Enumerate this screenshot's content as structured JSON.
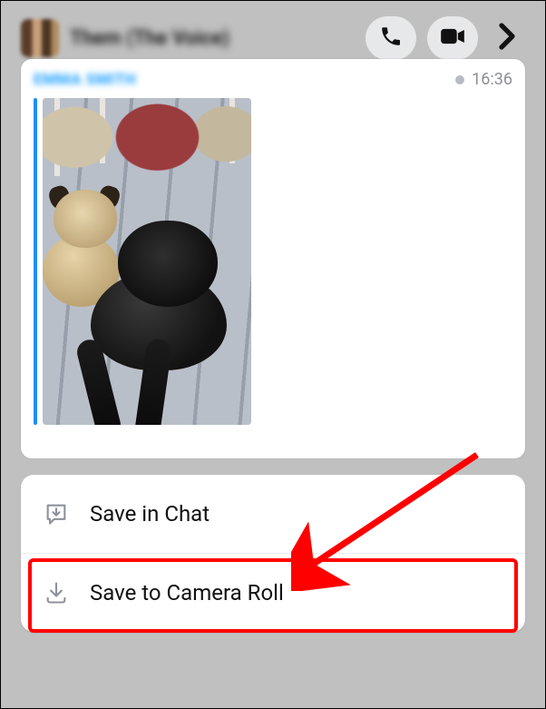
{
  "header": {
    "chat_name": "Them (The Voice)",
    "icons": {
      "call": "phone-icon",
      "video": "video-icon",
      "more": "chevron-right-icon"
    }
  },
  "message": {
    "sender": "EMMA SMITH",
    "timestamp": "16:36",
    "image_alt": "Photo of two pugs on a bed"
  },
  "menu": {
    "items": [
      {
        "label": "Save in Chat",
        "icon": "save-in-chat-icon"
      },
      {
        "label": "Save to Camera Roll",
        "icon": "download-icon"
      }
    ]
  },
  "annotation": {
    "highlight_target": "save-to-camera-roll-item",
    "arrow_color": "#ff0000"
  }
}
